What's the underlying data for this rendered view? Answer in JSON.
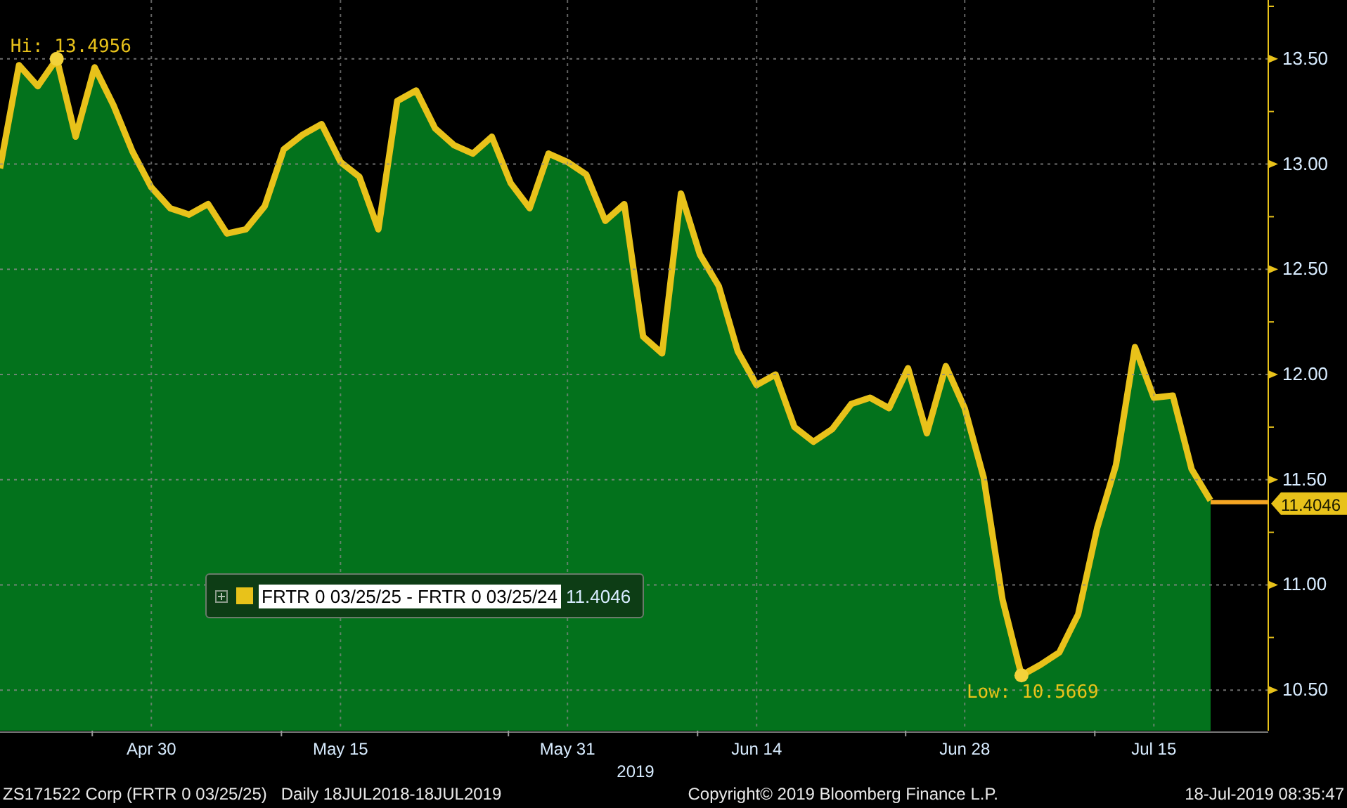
{
  "chart": {
    "chart_data": {
      "type": "area",
      "categories": [
        null,
        null,
        null,
        null,
        null,
        null,
        null,
        null,
        "Apr 30",
        null,
        null,
        null,
        null,
        null,
        null,
        null,
        null,
        null,
        "May 15",
        null,
        null,
        null,
        null,
        null,
        null,
        null,
        null,
        null,
        null,
        null,
        "May 31",
        null,
        null,
        null,
        null,
        null,
        null,
        null,
        null,
        null,
        "Jun 14",
        null,
        null,
        null,
        null,
        null,
        null,
        null,
        null,
        null,
        null,
        "Jun 28",
        null,
        null,
        null,
        null,
        null,
        null,
        null,
        null,
        null,
        "Jul 15",
        null,
        null,
        null
      ],
      "series": [
        {
          "name": "FRTR 0 03/25/25 - FRTR 0 03/25/24",
          "color": "#e8c21a",
          "values": [
            12.98,
            13.47,
            13.37,
            13.5,
            13.13,
            13.46,
            13.28,
            13.06,
            12.89,
            12.79,
            12.76,
            12.81,
            12.67,
            12.69,
            12.8,
            13.07,
            13.14,
            13.19,
            13.01,
            12.94,
            12.69,
            13.3,
            13.35,
            13.17,
            13.09,
            13.05,
            13.13,
            12.91,
            12.79,
            13.05,
            13.01,
            12.95,
            12.73,
            12.81,
            12.18,
            12.1,
            12.86,
            12.57,
            12.42,
            12.11,
            11.95,
            12.0,
            11.75,
            11.68,
            11.74,
            11.86,
            11.89,
            11.84,
            12.03,
            11.72,
            12.04,
            11.84,
            11.51,
            10.93,
            10.57,
            10.62,
            10.68,
            10.86,
            11.27,
            11.57,
            12.13,
            11.89,
            11.9,
            11.55,
            11.4
          ]
        }
      ],
      "grid": true,
      "ylim": [
        10.307,
        13.78
      ],
      "yticks": [
        {
          "value": 10.5,
          "label": "10.50"
        },
        {
          "value": 11,
          "label": "11.00"
        },
        {
          "value": 11.5,
          "label": "11.50"
        },
        {
          "value": 12,
          "label": "12.00"
        },
        {
          "value": 12.5,
          "label": "12.50"
        },
        {
          "value": 13,
          "label": "13.00"
        },
        {
          "value": 13.5,
          "label": "13.50"
        }
      ],
      "xlabel": "2019",
      "annotations": [
        "Hi: 13.4956",
        "Low: 10.5669"
      ]
    },
    "last_value": "11.4046",
    "legend": {
      "value": "11.4046",
      "highlighted": true
    }
  },
  "footer": {
    "security": "ZS171522 Corp (FRTR 0 03/25/25)",
    "period": "Daily 18JUL2018-18JUL2019",
    "copyright": "Copyright© 2019 Bloomberg Finance L.P.",
    "timestamp": "18-Jul-2019 08:35:47"
  }
}
